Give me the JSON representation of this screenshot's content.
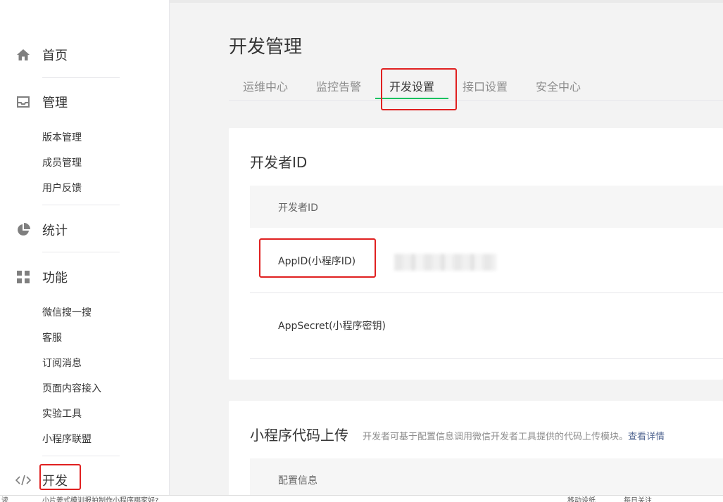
{
  "sidebar": {
    "home": {
      "label": "首页",
      "icon": "home-icon"
    },
    "manage": {
      "label": "管理",
      "icon": "inbox-icon",
      "items": [
        "版本管理",
        "成员管理",
        "用户反馈"
      ]
    },
    "stats": {
      "label": "统计",
      "icon": "pie-chart-icon"
    },
    "features": {
      "label": "功能",
      "icon": "grid-icon",
      "items": [
        "微信搜一搜",
        "客服",
        "订阅消息",
        "页面内容接入",
        "实验工具",
        "小程序联盟"
      ]
    },
    "dev": {
      "label": "开发",
      "icon": "code-icon"
    }
  },
  "main": {
    "title": "开发管理",
    "tabs": [
      "运维中心",
      "监控告警",
      "开发设置",
      "接口设置",
      "安全中心"
    ],
    "active_tab": "开发设置",
    "developer_id_card": {
      "title": "开发者ID",
      "table_header": "开发者ID",
      "rows": [
        "AppID(小程序ID)",
        "AppSecret(小程序密钥)"
      ]
    },
    "upload_card": {
      "title": "小程序代码上传",
      "hint": "开发者可基于配置信息调用微信开发者工具提供的代码上传模块。",
      "link": "查看详情",
      "table_header": "配置信息"
    }
  },
  "statusbar": {
    "left": "读",
    "middle": "小片姜式模训报拍制作小程序哪家好?",
    "r1": "移动设纸",
    "r2": "每日关注"
  },
  "colors": {
    "accent": "#07c160",
    "highlight": "#e02020",
    "link": "#576b95"
  }
}
